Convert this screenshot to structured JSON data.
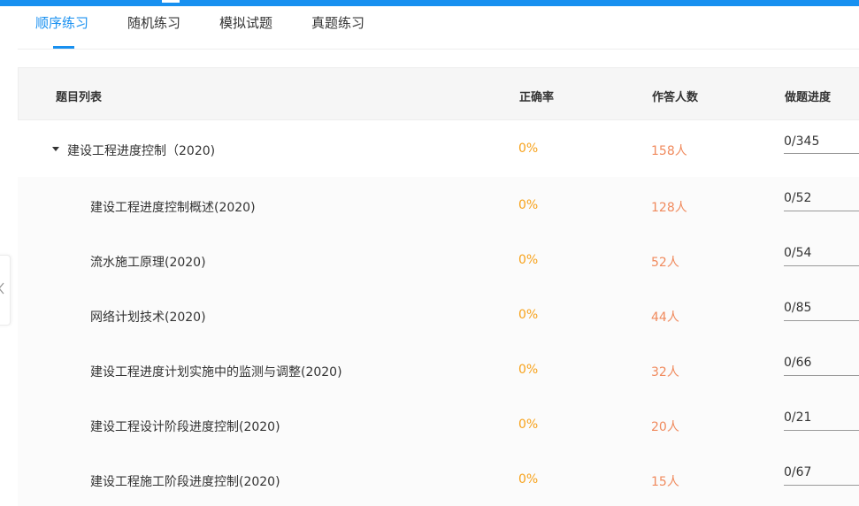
{
  "tabs": [
    {
      "label": "顺序练习",
      "active": true
    },
    {
      "label": "随机练习",
      "active": false
    },
    {
      "label": "模拟试题",
      "active": false
    },
    {
      "label": "真题练习",
      "active": false
    }
  ],
  "table": {
    "headers": {
      "name": "题目列表",
      "rate": "正确率",
      "count": "作答人数",
      "progress": "做题进度"
    },
    "parent": {
      "name": "建设工程进度控制（2020)",
      "rate": "0%",
      "count": "158人",
      "progress": "0/345"
    },
    "rows": [
      {
        "name": "建设工程进度控制概述(2020)",
        "rate": "0%",
        "count": "128人",
        "progress": "0/52"
      },
      {
        "name": "流水施工原理(2020)",
        "rate": "0%",
        "count": "52人",
        "progress": "0/54"
      },
      {
        "name": "网络计划技术(2020)",
        "rate": "0%",
        "count": "44人",
        "progress": "0/85"
      },
      {
        "name": "建设工程进度计划实施中的监测与调整(2020)",
        "rate": "0%",
        "count": "32人",
        "progress": "0/66"
      },
      {
        "name": "建设工程设计阶段进度控制(2020)",
        "rate": "0%",
        "count": "20人",
        "progress": "0/21"
      },
      {
        "name": "建设工程施工阶段进度控制(2020)",
        "rate": "0%",
        "count": "15人",
        "progress": "0/67"
      }
    ]
  },
  "colors": {
    "accent": "#1890f0",
    "rate": "#f7a21b",
    "count": "#f08a5d"
  },
  "icons": {
    "expand": "caret-down-icon",
    "collapse_panel": "chevron-left-icon"
  }
}
